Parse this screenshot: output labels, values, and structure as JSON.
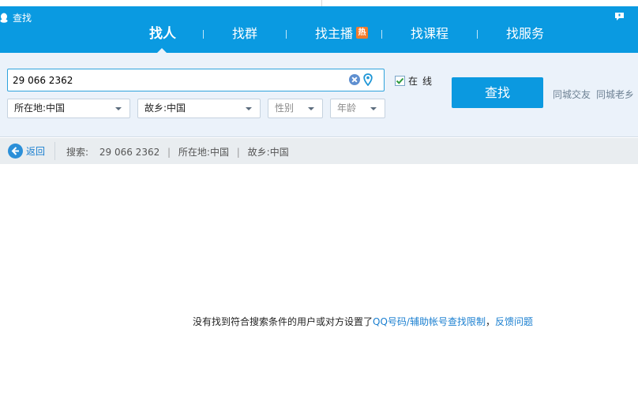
{
  "app": {
    "title": "查找"
  },
  "tabs": [
    {
      "label": "找人",
      "active": true
    },
    {
      "label": "找群",
      "active": false
    },
    {
      "label": "找主播",
      "active": false,
      "badge": "热"
    },
    {
      "label": "找课程",
      "active": false
    },
    {
      "label": "找服务",
      "active": false
    }
  ],
  "search": {
    "query": "29 066 2362",
    "online_label": "在线",
    "online_checked": true,
    "filters": {
      "location": "所在地:中国",
      "hometown": "故乡:中国",
      "gender": "性别",
      "age": "年龄"
    },
    "find_button": "查找",
    "quick_links": [
      "同城交友",
      "同城老乡"
    ]
  },
  "result_bar": {
    "back_label": "返回",
    "summary_prefix": "搜索:",
    "summary_query": "29 066 2362",
    "summary_location": "所在地:中国",
    "summary_hometown": "故乡:中国"
  },
  "empty_result": {
    "message": "没有找到符合搜索条件的用户或对方设置了",
    "link_limit": "QQ号码/辅助帐号查找限制",
    "comma": "，",
    "link_feedback": "反馈问题"
  },
  "colors": {
    "header": "#0a9ae1",
    "panel": "#ebf2fa",
    "accent": "#0b99e0",
    "link": "#1a7fd0",
    "badge": "#f27b2c"
  }
}
